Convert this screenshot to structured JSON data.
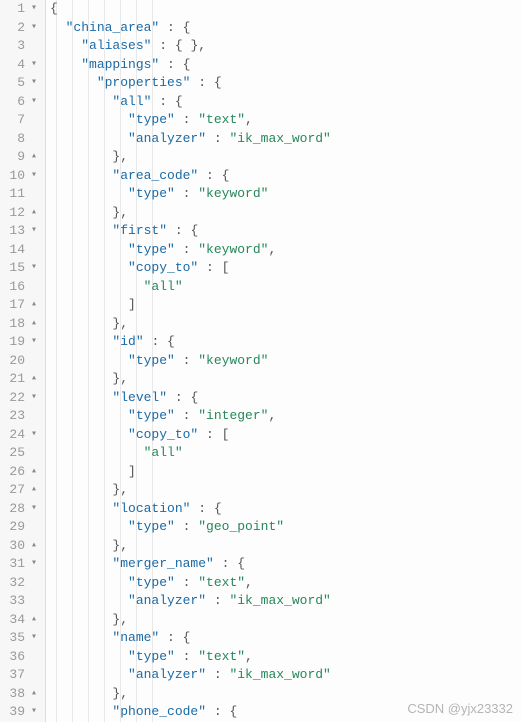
{
  "watermark": "CSDN @yjx23332",
  "lines": [
    {
      "num": "1",
      "fold": "▾",
      "indent": 0,
      "tokens": [
        [
          "brace",
          "{"
        ]
      ]
    },
    {
      "num": "2",
      "fold": "▾",
      "indent": 1,
      "tokens": [
        [
          "key",
          "\"china_area\""
        ],
        [
          "punc",
          " : "
        ],
        [
          "brace",
          "{"
        ]
      ]
    },
    {
      "num": "3",
      "fold": "",
      "indent": 2,
      "tokens": [
        [
          "key",
          "\"aliases\""
        ],
        [
          "punc",
          " : "
        ],
        [
          "brace",
          "{ }"
        ],
        [
          "punc",
          ","
        ]
      ]
    },
    {
      "num": "4",
      "fold": "▾",
      "indent": 2,
      "tokens": [
        [
          "key",
          "\"mappings\""
        ],
        [
          "punc",
          " : "
        ],
        [
          "brace",
          "{"
        ]
      ]
    },
    {
      "num": "5",
      "fold": "▾",
      "indent": 3,
      "tokens": [
        [
          "key",
          "\"properties\""
        ],
        [
          "punc",
          " : "
        ],
        [
          "brace",
          "{"
        ]
      ]
    },
    {
      "num": "6",
      "fold": "▾",
      "indent": 4,
      "tokens": [
        [
          "key",
          "\"all\""
        ],
        [
          "punc",
          " : "
        ],
        [
          "brace",
          "{"
        ]
      ]
    },
    {
      "num": "7",
      "fold": "",
      "indent": 5,
      "tokens": [
        [
          "key",
          "\"type\""
        ],
        [
          "punc",
          " : "
        ],
        [
          "str",
          "\"text\""
        ],
        [
          "punc",
          ","
        ]
      ]
    },
    {
      "num": "8",
      "fold": "",
      "indent": 5,
      "tokens": [
        [
          "key",
          "\"analyzer\""
        ],
        [
          "punc",
          " : "
        ],
        [
          "str",
          "\"ik_max_word\""
        ]
      ]
    },
    {
      "num": "9",
      "fold": "▴",
      "indent": 4,
      "tokens": [
        [
          "brace",
          "}"
        ],
        [
          "punc",
          ","
        ]
      ]
    },
    {
      "num": "10",
      "fold": "▾",
      "indent": 4,
      "tokens": [
        [
          "key",
          "\"area_code\""
        ],
        [
          "punc",
          " : "
        ],
        [
          "brace",
          "{"
        ]
      ]
    },
    {
      "num": "11",
      "fold": "",
      "indent": 5,
      "tokens": [
        [
          "key",
          "\"type\""
        ],
        [
          "punc",
          " : "
        ],
        [
          "str",
          "\"keyword\""
        ]
      ]
    },
    {
      "num": "12",
      "fold": "▴",
      "indent": 4,
      "tokens": [
        [
          "brace",
          "}"
        ],
        [
          "punc",
          ","
        ]
      ]
    },
    {
      "num": "13",
      "fold": "▾",
      "indent": 4,
      "tokens": [
        [
          "key",
          "\"first\""
        ],
        [
          "punc",
          " : "
        ],
        [
          "brace",
          "{"
        ]
      ]
    },
    {
      "num": "14",
      "fold": "",
      "indent": 5,
      "tokens": [
        [
          "key",
          "\"type\""
        ],
        [
          "punc",
          " : "
        ],
        [
          "str",
          "\"keyword\""
        ],
        [
          "punc",
          ","
        ]
      ]
    },
    {
      "num": "15",
      "fold": "▾",
      "indent": 5,
      "tokens": [
        [
          "key",
          "\"copy_to\""
        ],
        [
          "punc",
          " : "
        ],
        [
          "brace",
          "["
        ]
      ]
    },
    {
      "num": "16",
      "fold": "",
      "indent": 6,
      "tokens": [
        [
          "str",
          "\"all\""
        ]
      ]
    },
    {
      "num": "17",
      "fold": "▴",
      "indent": 5,
      "tokens": [
        [
          "brace",
          "]"
        ]
      ]
    },
    {
      "num": "18",
      "fold": "▴",
      "indent": 4,
      "tokens": [
        [
          "brace",
          "}"
        ],
        [
          "punc",
          ","
        ]
      ]
    },
    {
      "num": "19",
      "fold": "▾",
      "indent": 4,
      "tokens": [
        [
          "key",
          "\"id\""
        ],
        [
          "punc",
          " : "
        ],
        [
          "brace",
          "{"
        ]
      ]
    },
    {
      "num": "20",
      "fold": "",
      "indent": 5,
      "tokens": [
        [
          "key",
          "\"type\""
        ],
        [
          "punc",
          " : "
        ],
        [
          "str",
          "\"keyword\""
        ]
      ]
    },
    {
      "num": "21",
      "fold": "▴",
      "indent": 4,
      "tokens": [
        [
          "brace",
          "}"
        ],
        [
          "punc",
          ","
        ]
      ]
    },
    {
      "num": "22",
      "fold": "▾",
      "indent": 4,
      "tokens": [
        [
          "key",
          "\"level\""
        ],
        [
          "punc",
          " : "
        ],
        [
          "brace",
          "{"
        ]
      ]
    },
    {
      "num": "23",
      "fold": "",
      "indent": 5,
      "tokens": [
        [
          "key",
          "\"type\""
        ],
        [
          "punc",
          " : "
        ],
        [
          "str",
          "\"integer\""
        ],
        [
          "punc",
          ","
        ]
      ]
    },
    {
      "num": "24",
      "fold": "▾",
      "indent": 5,
      "tokens": [
        [
          "key",
          "\"copy_to\""
        ],
        [
          "punc",
          " : "
        ],
        [
          "brace",
          "["
        ]
      ]
    },
    {
      "num": "25",
      "fold": "",
      "indent": 6,
      "tokens": [
        [
          "str",
          "\"all\""
        ]
      ]
    },
    {
      "num": "26",
      "fold": "▴",
      "indent": 5,
      "tokens": [
        [
          "brace",
          "]"
        ]
      ]
    },
    {
      "num": "27",
      "fold": "▴",
      "indent": 4,
      "tokens": [
        [
          "brace",
          "}"
        ],
        [
          "punc",
          ","
        ]
      ]
    },
    {
      "num": "28",
      "fold": "▾",
      "indent": 4,
      "tokens": [
        [
          "key",
          "\"location\""
        ],
        [
          "punc",
          " : "
        ],
        [
          "brace",
          "{"
        ]
      ]
    },
    {
      "num": "29",
      "fold": "",
      "indent": 5,
      "tokens": [
        [
          "key",
          "\"type\""
        ],
        [
          "punc",
          " : "
        ],
        [
          "str",
          "\"geo_point\""
        ]
      ]
    },
    {
      "num": "30",
      "fold": "▴",
      "indent": 4,
      "tokens": [
        [
          "brace",
          "}"
        ],
        [
          "punc",
          ","
        ]
      ]
    },
    {
      "num": "31",
      "fold": "▾",
      "indent": 4,
      "tokens": [
        [
          "key",
          "\"merger_name\""
        ],
        [
          "punc",
          " : "
        ],
        [
          "brace",
          "{"
        ]
      ]
    },
    {
      "num": "32",
      "fold": "",
      "indent": 5,
      "tokens": [
        [
          "key",
          "\"type\""
        ],
        [
          "punc",
          " : "
        ],
        [
          "str",
          "\"text\""
        ],
        [
          "punc",
          ","
        ]
      ]
    },
    {
      "num": "33",
      "fold": "",
      "indent": 5,
      "tokens": [
        [
          "key",
          "\"analyzer\""
        ],
        [
          "punc",
          " : "
        ],
        [
          "str",
          "\"ik_max_word\""
        ]
      ]
    },
    {
      "num": "34",
      "fold": "▴",
      "indent": 4,
      "tokens": [
        [
          "brace",
          "}"
        ],
        [
          "punc",
          ","
        ]
      ]
    },
    {
      "num": "35",
      "fold": "▾",
      "indent": 4,
      "tokens": [
        [
          "key",
          "\"name\""
        ],
        [
          "punc",
          " : "
        ],
        [
          "brace",
          "{"
        ]
      ]
    },
    {
      "num": "36",
      "fold": "",
      "indent": 5,
      "tokens": [
        [
          "key",
          "\"type\""
        ],
        [
          "punc",
          " : "
        ],
        [
          "str",
          "\"text\""
        ],
        [
          "punc",
          ","
        ]
      ]
    },
    {
      "num": "37",
      "fold": "",
      "indent": 5,
      "tokens": [
        [
          "key",
          "\"analyzer\""
        ],
        [
          "punc",
          " : "
        ],
        [
          "str",
          "\"ik_max_word\""
        ]
      ]
    },
    {
      "num": "38",
      "fold": "▴",
      "indent": 4,
      "tokens": [
        [
          "brace",
          "}"
        ],
        [
          "punc",
          ","
        ]
      ]
    },
    {
      "num": "39",
      "fold": "▾",
      "indent": 4,
      "tokens": [
        [
          "key",
          "\"phone_code\""
        ],
        [
          "punc",
          " : "
        ],
        [
          "brace",
          "{"
        ]
      ]
    }
  ]
}
